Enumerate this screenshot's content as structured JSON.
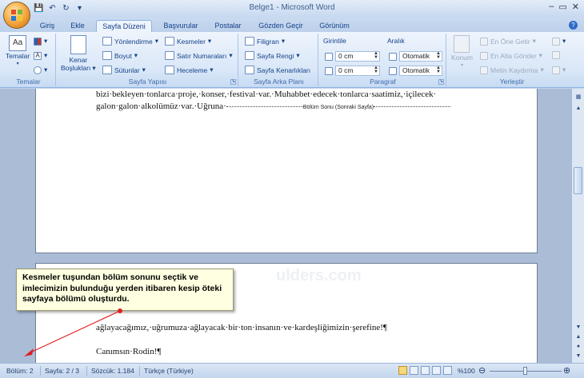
{
  "title_bar": {
    "title": "Belge1 - Microsoft Word",
    "minimize": "–",
    "maximize": "▭",
    "close": "✕"
  },
  "quick_access": {
    "save_icon": "save-icon",
    "undo_icon": "undo-icon",
    "redo_icon": "redo-icon",
    "customize": "▾"
  },
  "tabs": [
    {
      "label": "Giriş"
    },
    {
      "label": "Ekle"
    },
    {
      "label": "Sayfa Düzeni",
      "active": true
    },
    {
      "label": "Başvurular"
    },
    {
      "label": "Postalar"
    },
    {
      "label": "Gözden Geçir"
    },
    {
      "label": "Görünüm"
    }
  ],
  "ribbon": {
    "temalar": {
      "button": "Temalar",
      "group": "Temalar"
    },
    "sayfa_yapisi": {
      "kenar_line1": "Kenar",
      "kenar_line2": "Boşlukları",
      "yonlendirme": "Yönlendirme",
      "boyut": "Boyut",
      "sutunlar": "Sütunlar",
      "kesmeler": "Kesmeler",
      "satir_numaralari": "Satır Numaraları",
      "heceleme": "Heceleme",
      "group": "Sayfa Yapısı"
    },
    "sayfa_arka_plani": {
      "filigran": "Filigran",
      "sayfa_rengi": "Sayfa Rengi",
      "sayfa_kenarliklari": "Sayfa Kenarlıkları",
      "group": "Sayfa Arka Planı"
    },
    "paragraf": {
      "girinti": "Girintile",
      "aralik": "Aralık",
      "girinti_sol": "0 cm",
      "girinti_sag": "0 cm",
      "aralik_once": "Otomatik",
      "aralik_sonra": "Otomatik",
      "group": "Paragraf"
    },
    "yerlestir": {
      "konum": "Konum",
      "en_one_getir": "En Öne Getir",
      "en_alta_gonder": "En Alta Gönder",
      "metin_kaydirma": "Metin Kaydırma",
      "group": "Yerleştir"
    }
  },
  "document": {
    "page1_line1": "bizi·bekleyen·tonlarca·proje,·konser,·festival·var.·Muhabbet·edecek·tonlarca·saatimiz,·içilecek·",
    "page1_line2": "galon·galon·alkolümüz·var.·Uğruna·",
    "section_break_label": "Bölüm Sonu (Sonraki Sayfa)",
    "watermark": "ulders.com",
    "page2_line1": "ağlayacağımız,·uğrumuza·ağlayacak·bir·ton·insanın·ve·kardeşliğimizin·şerefine!¶",
    "page2_line2": "Canımsın·Rodin!¶"
  },
  "callout": {
    "text": "Kesmeler tuşundan bölüm sonunu seçtik ve imlecimizin bulunduğu yerden itibaren kesip öteki sayfaya bölümü oluşturdu."
  },
  "status_bar": {
    "bolum": "Bölüm: 2",
    "sayfa": "Sayfa: 2 / 3",
    "sozcuk": "Sözcük: 1.184",
    "dil": "Türkçe (Türkiye)",
    "zoom": "%100",
    "zoom_level_percent": 100
  },
  "colors": {
    "ribbon_text": "#15428b",
    "callout_bg": "#ffffe1",
    "arrow": "#e02020"
  }
}
